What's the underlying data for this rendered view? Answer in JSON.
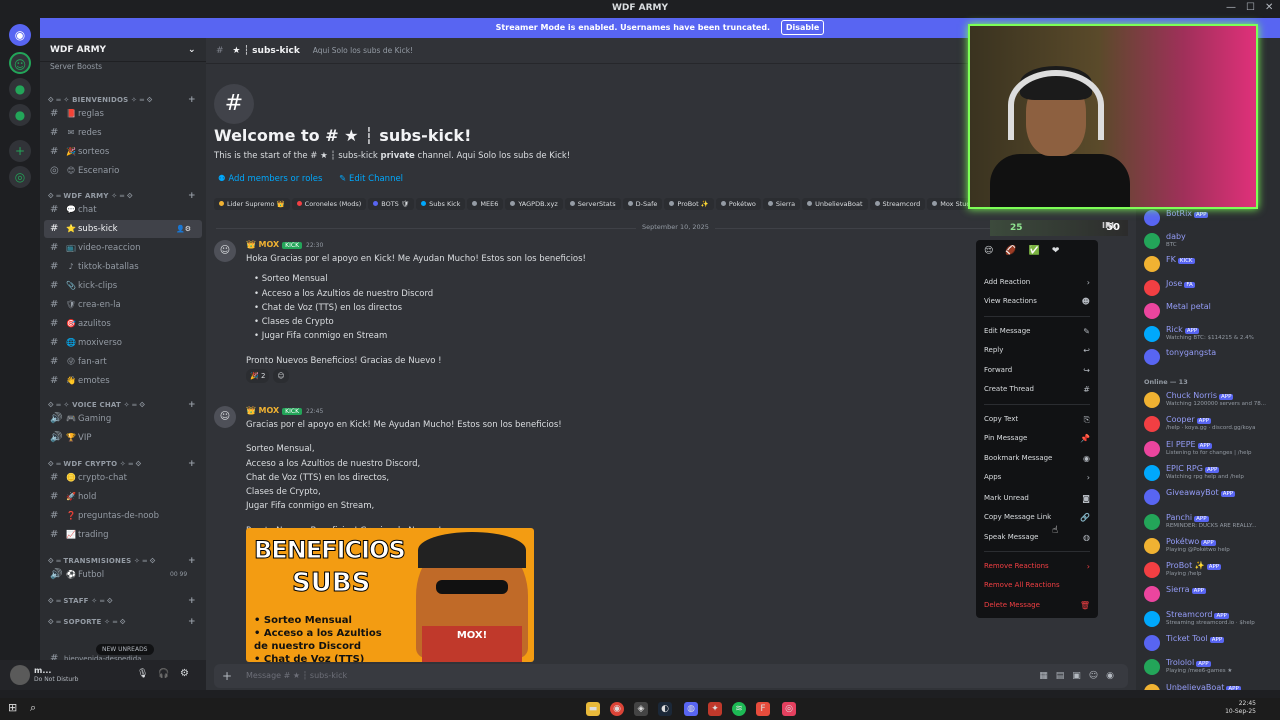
{
  "titlebar": {
    "title": "WDF ARMY",
    "min": "—",
    "max": "☐",
    "close": "✕"
  },
  "banner": {
    "text": "Streamer Mode is enabled. Usernames have been truncated.",
    "button": "Disable"
  },
  "server": {
    "name": "WDF ARMY",
    "boosts": "Server Boosts"
  },
  "channels": {
    "categories": [
      {
        "label": "⟐ ═ ✧ BIENVENIDOS ✧ ═ ⟐"
      },
      {
        "label": "⟐ ═ WDF ARMY ✧ ═ ⟐"
      },
      {
        "label": "⟐ ═ ✧ VOICE CHAT ✧ ═ ⟐"
      },
      {
        "label": "⟐ ═ WDF CRYPTO ✧ ═ ⟐"
      },
      {
        "label": "⟐ ═ TRANSMISIONES ✧ ═ ⟐"
      },
      {
        "label": "⟐ ═ Staff ✧ ═ ⟐"
      },
      {
        "label": "⟐ ═ Soporte ✧ ═ ⟐"
      }
    ],
    "items": [
      "reglas",
      "redes",
      "sorteos",
      "Escenario",
      "chat",
      "subs-kick",
      "video-reaccion",
      "tiktok-batallas",
      "kick-clips",
      "crea-en-la",
      "azulitos",
      "moxiverso",
      "fan-art",
      "emotes",
      "Gaming",
      "VIP",
      "crypto-chat",
      "hold",
      "preguntas-de-noob",
      "trading",
      "Futbol"
    ],
    "futbol_count": "00  99",
    "new_unreads": "NEW UNREADS",
    "last_item": "bienvenida-despedida"
  },
  "user": {
    "name": "m...",
    "status": "Do Not Disturb"
  },
  "header": {
    "channel": "★ ┆ subs-kick",
    "topic": "Aqui Solo los subs de Kick!"
  },
  "welcome": {
    "hash": "#",
    "title": "Welcome to # ★ ┆ subs-kick!",
    "sub_a": "This is the start of the # ★ ┆ subs-kick ",
    "sub_b": "private",
    "sub_c": " channel. Aqui Solo los subs de Kick!",
    "add_members": "Add members or roles",
    "edit_channel": "Edit Channel"
  },
  "roles": [
    {
      "label": "Lider Supremo 👑",
      "color": "#f0b232"
    },
    {
      "label": "Coroneles (Mods)",
      "color": "#f23f43"
    },
    {
      "label": "BOTS 🛡",
      "color": "#5865f2"
    },
    {
      "label": "Subs Kick",
      "color": "#00a8fc"
    },
    {
      "label": "MEE6",
      "color": "#949ba4"
    },
    {
      "label": "YAGPDB.xyz",
      "color": "#949ba4"
    },
    {
      "label": "ServerStats",
      "color": "#949ba4"
    },
    {
      "label": "D-Safe",
      "color": "#949ba4"
    },
    {
      "label": "ProBot ✨",
      "color": "#949ba4"
    },
    {
      "label": "Pokétwo",
      "color": "#949ba4"
    },
    {
      "label": "Sierra",
      "color": "#949ba4"
    },
    {
      "label": "UnbelievaBoat",
      "color": "#949ba4"
    },
    {
      "label": "Streamcord",
      "color": "#949ba4"
    },
    {
      "label": "Mox Studios",
      "color": "#949ba4"
    }
  ],
  "date_sep": "September 10, 2025",
  "messages": [
    {
      "name": "MOX",
      "badge": "KICK",
      "time": "22:30",
      "text": "Hoka Gracias por el apoyo en Kick! Me Ayudan Mucho! Estos son los beneficios!",
      "bullets": [
        "Sorteo Mensual",
        "Acceso a los Azultios de nuestro Discord",
        "Chat de Voz (TTS) en los directos",
        "Clases de Crypto",
        "Jugar Fifa conmigo en Stream"
      ],
      "footer": "Pronto Nuevos Beneficios! Gracias de Nuevo !",
      "reaction_count": "2"
    },
    {
      "name": "MOX",
      "badge": "KICK",
      "time": "22:45",
      "text": "Gracias por el apoyo en Kick! Me Ayudan Mucho! Estos son los beneficios!",
      "lines": [
        "Sorteo Mensual,",
        "Acceso a los Azultios de nuestro Discord,",
        "Chat de Voz (TTS) en los directos,",
        "Clases de Crypto,",
        "Jugar Fifa conmigo en Stream,"
      ],
      "footer": "Pronto Nuevos Beneficios! Gracias de Nuevo !"
    }
  ],
  "image": {
    "line1": "BENEFICIOS",
    "line2": "SUBS",
    "items": [
      "• Sorteo Mensual",
      "• Acceso a los Azultios",
      "   de nuestro Discord",
      "• Chat de Voz (TTS)"
    ],
    "shirt": "MOX!"
  },
  "composer": {
    "placeholder": "Message # ★ ┆ subs-kick"
  },
  "overlay": {
    "left": "25",
    "right": "50",
    "mid": "IRL"
  },
  "context_menu": {
    "items": [
      {
        "label": "Add Reaction",
        "icon": "›"
      },
      {
        "label": "View Reactions",
        "icon": "☻"
      },
      {
        "label": "Edit Message",
        "icon": "✎"
      },
      {
        "label": "Reply",
        "icon": "↩"
      },
      {
        "label": "Forward",
        "icon": "↪"
      },
      {
        "label": "Create Thread",
        "icon": "#"
      },
      {
        "label": "Copy Text",
        "icon": "⎘"
      },
      {
        "label": "Pin Message",
        "icon": "📌"
      },
      {
        "label": "Bookmark Message",
        "icon": "◉"
      },
      {
        "label": "Apps",
        "icon": "›"
      },
      {
        "label": "Mark Unread",
        "icon": "◙"
      },
      {
        "label": "Copy Message Link",
        "icon": "🔗"
      },
      {
        "label": "Speak Message",
        "icon": "◍"
      },
      {
        "label": "Remove Reactions",
        "icon": "›"
      },
      {
        "label": "Remove All Reactions",
        "icon": ""
      },
      {
        "label": "Delete Message",
        "icon": "🗑"
      }
    ]
  },
  "members": {
    "online_header": "Online — 13",
    "top": [
      {
        "name": "BotRix",
        "app": "APP",
        "status": ""
      },
      {
        "name": "daby",
        "app": "",
        "status": "BTC"
      },
      {
        "name": "FK",
        "app": "KICK",
        "status": ""
      },
      {
        "name": "Jose",
        "app": "FA",
        "status": ""
      },
      {
        "name": "Metal petal",
        "app": "",
        "status": ""
      },
      {
        "name": "Rick",
        "app": "APP",
        "status": "Watching BTC: $114215 & 2.4%"
      },
      {
        "name": "tonygangsta",
        "app": "",
        "status": ""
      }
    ],
    "online": [
      {
        "name": "Chuck Norris",
        "app": "APP",
        "status": "Watching 1200000 servers and 78..."
      },
      {
        "name": "Cooper",
        "app": "APP",
        "status": "/help · koya.gg · discord.gg/koya"
      },
      {
        "name": "El PEPE",
        "app": "APP",
        "status": "Listening to for changes | /help"
      },
      {
        "name": "EPIC RPG",
        "app": "APP",
        "status": "Watching rpg help and /help"
      },
      {
        "name": "GiveawayBot",
        "app": "APP",
        "status": ""
      },
      {
        "name": "Panchi",
        "app": "APP",
        "status": "REMINDER: DUCKS ARE REALLY..."
      },
      {
        "name": "Pokétwo",
        "app": "APP",
        "status": "Playing @Pokétwo help"
      },
      {
        "name": "ProBot ✨",
        "app": "APP",
        "status": "Playing /help"
      },
      {
        "name": "Sierra",
        "app": "APP",
        "status": ""
      },
      {
        "name": "Streamcord",
        "app": "APP",
        "status": "Streaming streamcord.io · $help"
      },
      {
        "name": "Ticket Tool",
        "app": "APP",
        "status": ""
      },
      {
        "name": "Trololol",
        "app": "APP",
        "status": "Playing /mee6-games ★"
      },
      {
        "name": "UnbelievaBoat",
        "app": "APP",
        "status": ""
      }
    ]
  },
  "taskbar": {
    "time": "22:45",
    "date": "10-Sep-25"
  }
}
